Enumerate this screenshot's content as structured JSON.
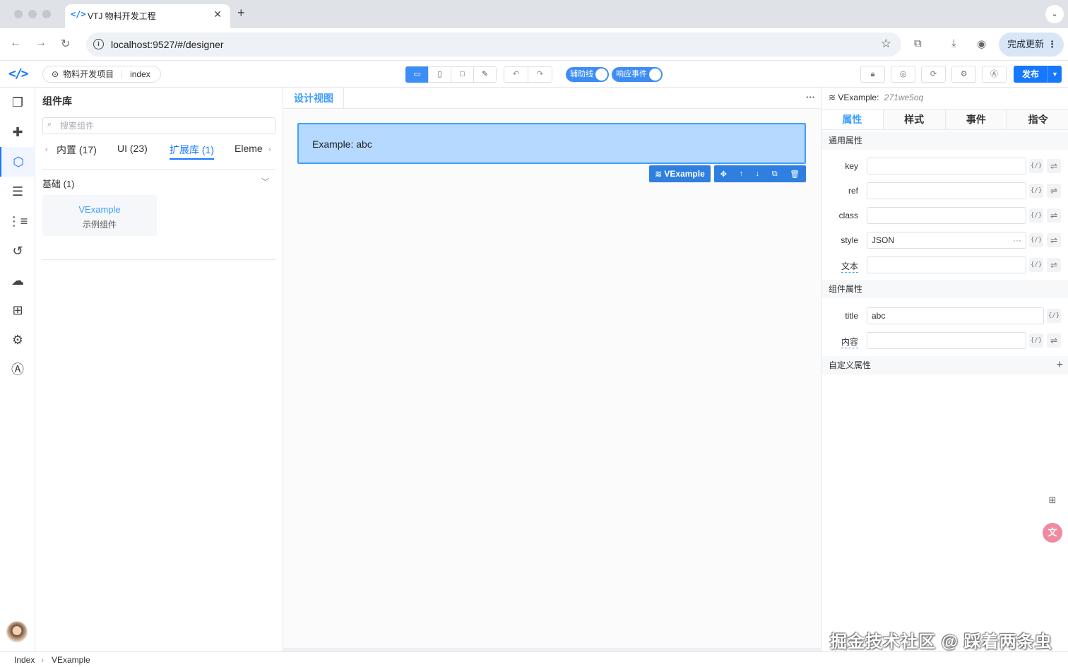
{
  "browser": {
    "tab_icon": "</>",
    "tab_title": "VTJ 物料开发工程",
    "url": "localhost:9527/#/designer",
    "update_label": "完成更新"
  },
  "toolbar": {
    "logo": "</>",
    "project_name": "物料开发项目",
    "page_name": "index",
    "switch_guides": "辅助线",
    "switch_events": "响应事件",
    "publish_label": "发布"
  },
  "component_panel": {
    "title": "组件库",
    "search_placeholder": "搜索组件",
    "tabs": [
      {
        "label": "内置 (17)",
        "active": false
      },
      {
        "label": "UI (23)",
        "active": false
      },
      {
        "label": "扩展库 (1)",
        "active": true
      },
      {
        "label": "Eleme",
        "active": false
      }
    ],
    "group_title": "基础 (1)",
    "components": [
      {
        "name": "VExample",
        "desc": "示例组件"
      }
    ]
  },
  "designer": {
    "tab_label": "设计视图",
    "component_text": "Example: abc",
    "selected_label": "VExample"
  },
  "props_panel": {
    "component": "VExample:",
    "node_id": "271we5oq",
    "tabs": [
      "属性",
      "样式",
      "事件",
      "指令"
    ],
    "active_tab": "属性",
    "sections": {
      "common": "通用属性",
      "component": "组件属性",
      "custom": "自定义属性"
    },
    "common_props": [
      {
        "label": "key",
        "value": ""
      },
      {
        "label": "ref",
        "value": ""
      },
      {
        "label": "class",
        "value": ""
      },
      {
        "label": "style",
        "value": "JSON"
      },
      {
        "label": "文本",
        "value": ""
      }
    ],
    "component_props": [
      {
        "label": "title",
        "value": "abc"
      },
      {
        "label": "内容",
        "value": ""
      }
    ]
  },
  "watermark": "掘金技术社区 @ 踩着两条虫",
  "breadcrumb": [
    "Index",
    "VExample"
  ],
  "colors": {
    "accent": "#1677ff",
    "selection_fill": "#b6daff",
    "selection_border": "#409eff"
  }
}
